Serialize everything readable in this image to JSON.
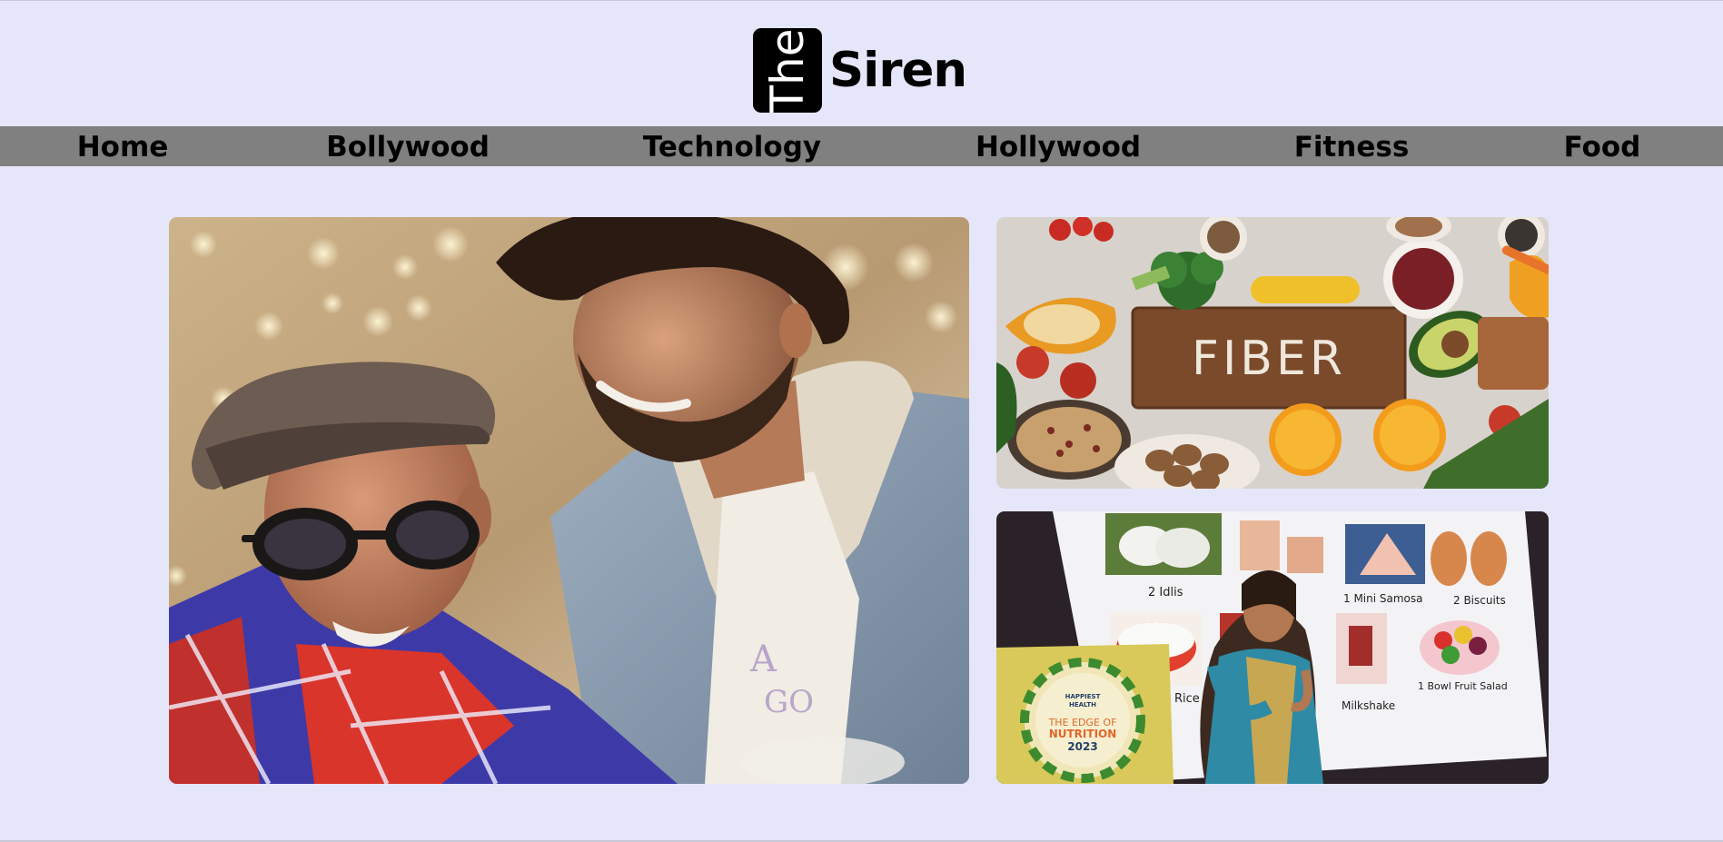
{
  "logo": {
    "box_text": "The",
    "word": "Siren"
  },
  "nav": {
    "items": [
      {
        "label": "Home"
      },
      {
        "label": "Bollywood"
      },
      {
        "label": "Technology"
      },
      {
        "label": "Hollywood"
      },
      {
        "label": "Fitness"
      },
      {
        "label": "Food"
      }
    ]
  },
  "cards": {
    "fiber": {
      "board_text": "FIBER"
    },
    "nutrition": {
      "slide_labels": {
        "idlis": "2  Idlis",
        "samosa": "1 Mini Samosa",
        "biscuits": "2 Biscuits",
        "rice": "Rice",
        "milkshake": "Milkshake",
        "fruit_salad": "1 Bowl  Fruit Salad"
      },
      "podium": {
        "brand_line1": "HAPPIEST",
        "brand_line2": "HEALTH",
        "event_line1": "THE EDGE OF",
        "event_line2": "NUTRITION",
        "year": "2023"
      }
    }
  },
  "colors": {
    "page_bg": "#e6e6fa",
    "nav_bg": "#808080",
    "text": "#000000"
  }
}
